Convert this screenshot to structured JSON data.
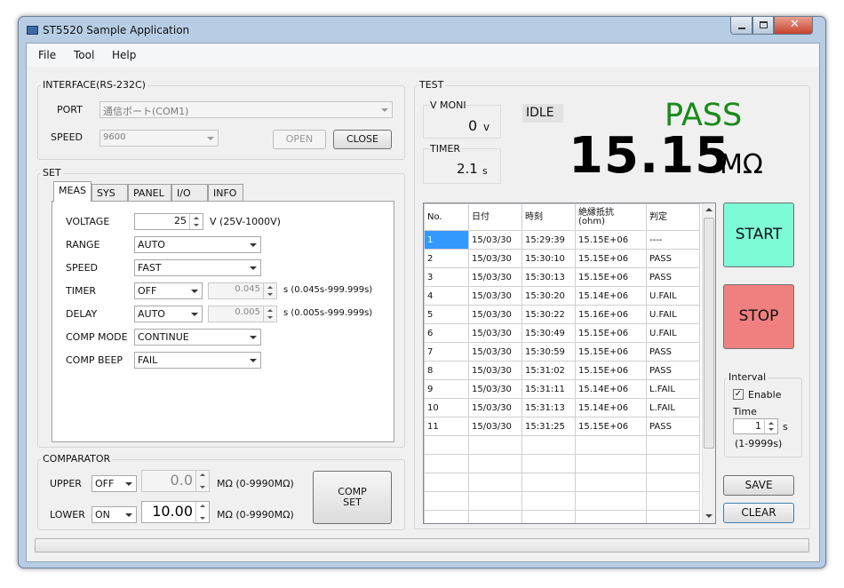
{
  "window": {
    "title": "ST5520 Sample Application"
  },
  "menu": [
    "File",
    "Tool",
    "Help"
  ],
  "interface": {
    "title": "INTERFACE(RS-232C)",
    "port_label": "PORT",
    "port_value": "通信ポート(COM1)",
    "speed_label": "SPEED",
    "speed_value": "9600",
    "open_label": "OPEN",
    "close_label": "CLOSE"
  },
  "set": {
    "title": "SET",
    "tabs": [
      "MEAS",
      "SYS",
      "PANEL",
      "I/O",
      "INFO"
    ],
    "voltage_label": "VOLTAGE",
    "voltage_value": "25",
    "voltage_unit": "V (25V-1000V)",
    "range_label": "RANGE",
    "range_value": "AUTO",
    "speed_label": "SPEED",
    "speed_value": "FAST",
    "timer_label": "TIMER",
    "timer_mode": "OFF",
    "timer_value": "0.045",
    "timer_unit": "s (0.045s-999.999s)",
    "delay_label": "DELAY",
    "delay_mode": "AUTO",
    "delay_value": "0.005",
    "delay_unit": "s (0.005s-999.999s)",
    "comp_mode_label": "COMP MODE",
    "comp_mode_value": "CONTINUE",
    "comp_beep_label": "COMP BEEP",
    "comp_beep_value": "FAIL"
  },
  "comparator": {
    "title": "COMPARATOR",
    "upper_label": "UPPER",
    "upper_mode": "OFF",
    "upper_value": "0.0",
    "upper_unit": "MΩ (0-9990MΩ)",
    "lower_label": "LOWER",
    "lower_mode": "ON",
    "lower_value": "10.00",
    "lower_unit": "MΩ (0-9990MΩ)",
    "comp_set_line1": "COMP",
    "comp_set_line2": "SET"
  },
  "test": {
    "title": "TEST",
    "vmoni_label": "V MONI",
    "vmoni_value": "0",
    "vmoni_unit": "v",
    "timer_label": "TIMER",
    "timer_value": "2.1",
    "timer_unit": "s",
    "status": "IDLE",
    "judgment": "PASS",
    "judgment_color": "#1a8a1a",
    "reading_value": "15.15",
    "reading_unit": "MΩ"
  },
  "table": {
    "headers": [
      "No.",
      "日付",
      "時刻",
      "絶縁抵抗\n(ohm)",
      "判定"
    ],
    "rows": [
      [
        "1",
        "15/03/30",
        "15:29:39",
        "15.15E+06",
        "----"
      ],
      [
        "2",
        "15/03/30",
        "15:30:10",
        "15.15E+06",
        "PASS"
      ],
      [
        "3",
        "15/03/30",
        "15:30:13",
        "15.15E+06",
        "PASS"
      ],
      [
        "4",
        "15/03/30",
        "15:30:20",
        "15.14E+06",
        "U.FAIL"
      ],
      [
        "5",
        "15/03/30",
        "15:30:22",
        "15.16E+06",
        "U.FAIL"
      ],
      [
        "6",
        "15/03/30",
        "15:30:49",
        "15.15E+06",
        "U.FAIL"
      ],
      [
        "7",
        "15/03/30",
        "15:30:59",
        "15.15E+06",
        "PASS"
      ],
      [
        "8",
        "15/03/30",
        "15:31:02",
        "15.15E+06",
        "PASS"
      ],
      [
        "9",
        "15/03/30",
        "15:31:11",
        "15.14E+06",
        "L.FAIL"
      ],
      [
        "10",
        "15/03/30",
        "15:31:13",
        "15.14E+06",
        "L.FAIL"
      ],
      [
        "11",
        "15/03/30",
        "15:31:25",
        "15.15E+06",
        "PASS"
      ]
    ],
    "empty_rows": 5
  },
  "controls": {
    "start_label": "START",
    "start_color": "#7dfad6",
    "stop_label": "STOP",
    "stop_color": "#f08080",
    "interval_title": "Interval",
    "enable_label": "Enable",
    "enable_checked": true,
    "time_label": "Time",
    "time_value": "1",
    "time_unit": "s",
    "time_range": "(1-9999s)",
    "save_label": "SAVE",
    "clear_label": "CLEAR"
  },
  "icons": {
    "app": "app-icon",
    "minimize": "minimize-icon",
    "maximize": "maximize-icon",
    "close": "close-icon"
  }
}
